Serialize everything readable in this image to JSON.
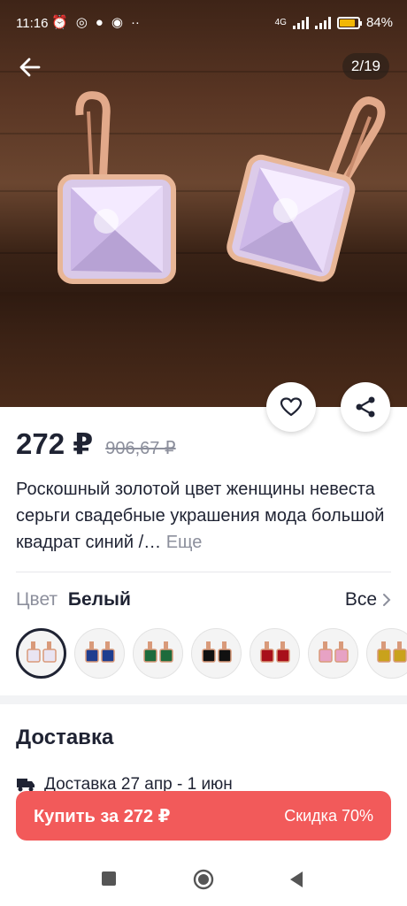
{
  "status": {
    "time": "11:16",
    "icons": [
      "alarm-icon",
      "chat-icon",
      "viber-icon",
      "sync-icon",
      "more-dots-icon"
    ],
    "network": "4G",
    "battery": "84%",
    "battery_level": 0.84
  },
  "gallery": {
    "counter": "2/19"
  },
  "product": {
    "price": "272 ₽",
    "old_price": "906,67 ₽",
    "title": "Роскошный золотой цвет женщины невеста серьги свадебные украшения мода большой квадрат синий /…",
    "more_label": "Еще"
  },
  "color": {
    "label": "Цвет",
    "value": "Белый",
    "all_label": "Все",
    "swatches": [
      {
        "name": "white",
        "color": "#e9e4f2"
      },
      {
        "name": "blue",
        "color": "#1e3d8f"
      },
      {
        "name": "green",
        "color": "#1d6b3c"
      },
      {
        "name": "black",
        "color": "#111111"
      },
      {
        "name": "red",
        "color": "#a8101a"
      },
      {
        "name": "pink",
        "color": "#e7a2c4"
      },
      {
        "name": "yellow",
        "color": "#c9a21c"
      }
    ]
  },
  "delivery": {
    "title": "Доставка",
    "info": "Доставка 27 апр - 1 июн"
  },
  "buy": {
    "label": "Купить за 272 ₽",
    "discount": "Скидка 70%",
    "color": "#f25a5a"
  }
}
